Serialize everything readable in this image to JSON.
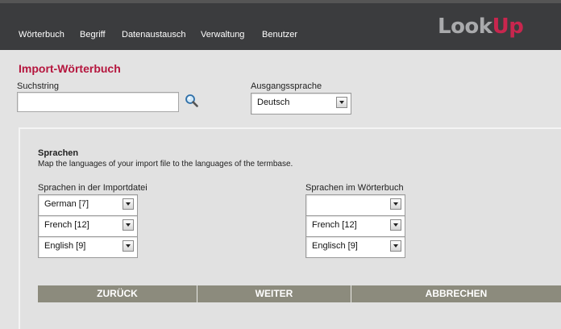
{
  "brand": {
    "logo_part1": "Look",
    "logo_part2": "Up"
  },
  "nav": {
    "items": [
      {
        "label": "Wörterbuch"
      },
      {
        "label": "Begriff"
      },
      {
        "label": "Datenaustausch"
      },
      {
        "label": "Verwaltung"
      },
      {
        "label": "Benutzer"
      }
    ]
  },
  "page": {
    "title": "Import-Wörterbuch"
  },
  "search": {
    "label": "Suchstring",
    "value": ""
  },
  "source_language": {
    "label": "Ausgangssprache",
    "selected": "Deutsch"
  },
  "languages": {
    "heading": "Sprachen",
    "description": "Map the languages of your import file to the languages of the termbase.",
    "import_label": "Sprachen in der Importdatei",
    "import_values": [
      "German [7]",
      "French [12]",
      "English [9]"
    ],
    "dictionary_label": "Sprachen im Wörterbuch",
    "dictionary_values": [
      "",
      "French [12]",
      "Englisch [9]"
    ]
  },
  "buttons": {
    "back": "ZURÜCK",
    "next": "WEITER",
    "cancel": "ABBRECHEN"
  },
  "colors": {
    "header": "#3b3c3e",
    "accent": "#c8264e",
    "button_bar": "#8c8b7d"
  }
}
